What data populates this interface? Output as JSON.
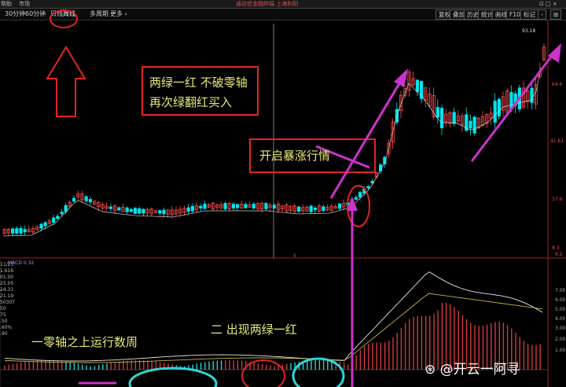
{
  "topbar": {
    "help": "帮助",
    "market": "市场",
    "title": "通达信金融终端 上海利阳",
    "right": "⊡ □ ×"
  },
  "toolbar": {
    "periods": [
      "30分钟",
      "60分钟",
      "日线",
      "周线",
      "多周期",
      "更多 ›"
    ],
    "selected_period": "周线",
    "tools": [
      "复权",
      "叠加",
      "历史",
      "统计",
      "画线",
      "F10",
      "标记",
      "-",
      "⊞"
    ]
  },
  "price_axis": {
    "high_marker": "93.18",
    "ticks": [
      "64.6",
      "41.61",
      "37.6",
      "8.3"
    ],
    "low_label": "9.2"
  },
  "left_panel": {
    "values": [
      "11/23",
      "1.616",
      "01.00",
      "25.05",
      "24.31",
      "21.19",
      "50307",
      "50",
      "75",
      ".50",
      ".60%",
      ".90"
    ]
  },
  "macd_label": "MACD 0.32",
  "macd_axis": {
    "ticks": [
      "7.00",
      "6.00",
      "5.00",
      "4.00",
      "3.00",
      "2.00",
      "1.00"
    ]
  },
  "annotations": {
    "box1_line1": "两绿一红 不破零轴",
    "box1_line2": "再次绿翻红买入",
    "box2": "开启暴涨行情",
    "text_zero_axis": "一零轴之上运行数周",
    "text_two_green": "二  出现两绿一红"
  },
  "watermark": "⊛ @开云一阿寻",
  "colors": {
    "up_candle": "#ff4d4d",
    "down_candle": "#00e5ee",
    "annotation_red": "#e22525",
    "arrow_magenta": "#cc33cc",
    "circle_cyan": "#2fd6d6",
    "annotation_text": "#e8e87a"
  }
}
